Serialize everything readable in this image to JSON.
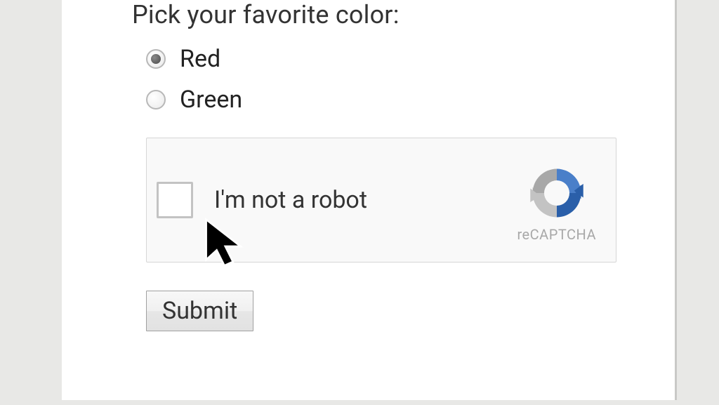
{
  "question": "Pick your favorite color:",
  "options": [
    {
      "label": "Red",
      "selected": true
    },
    {
      "label": "Green",
      "selected": false
    }
  ],
  "recaptcha": {
    "label": "I'm not a robot",
    "brand": "reCAPTCHA"
  },
  "submit_label": "Submit"
}
